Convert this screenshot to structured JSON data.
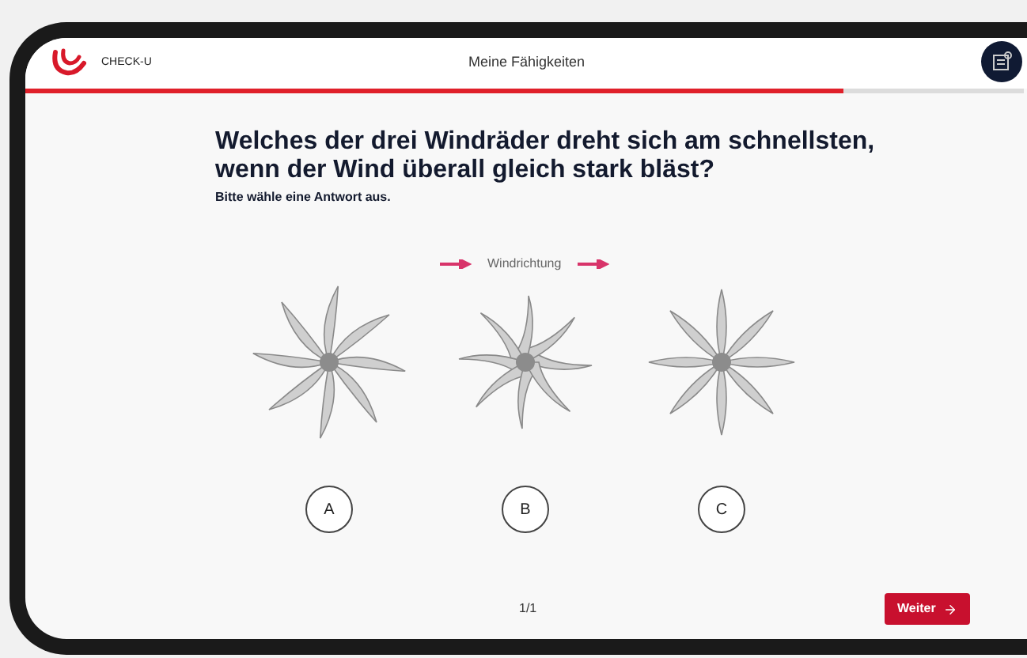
{
  "header": {
    "brand": "CHECK-U",
    "title": "Meine Fähigkeiten"
  },
  "progress": {
    "level": 0.82
  },
  "question": {
    "text": "Welches der drei Windräder dreht sich am schnellsten, wenn der Wind überall gleich stark bläst?",
    "hint": "Bitte wähle eine Antwort aus."
  },
  "wind_label": "Windrichtung",
  "options": [
    {
      "label": "A",
      "kind": "curved",
      "selected": false
    },
    {
      "label": "B",
      "kind": "reversed",
      "selected": false
    },
    {
      "label": "C",
      "kind": "straight",
      "selected": false
    }
  ],
  "footer": {
    "page": "1/1",
    "next_button": "Weiter"
  }
}
